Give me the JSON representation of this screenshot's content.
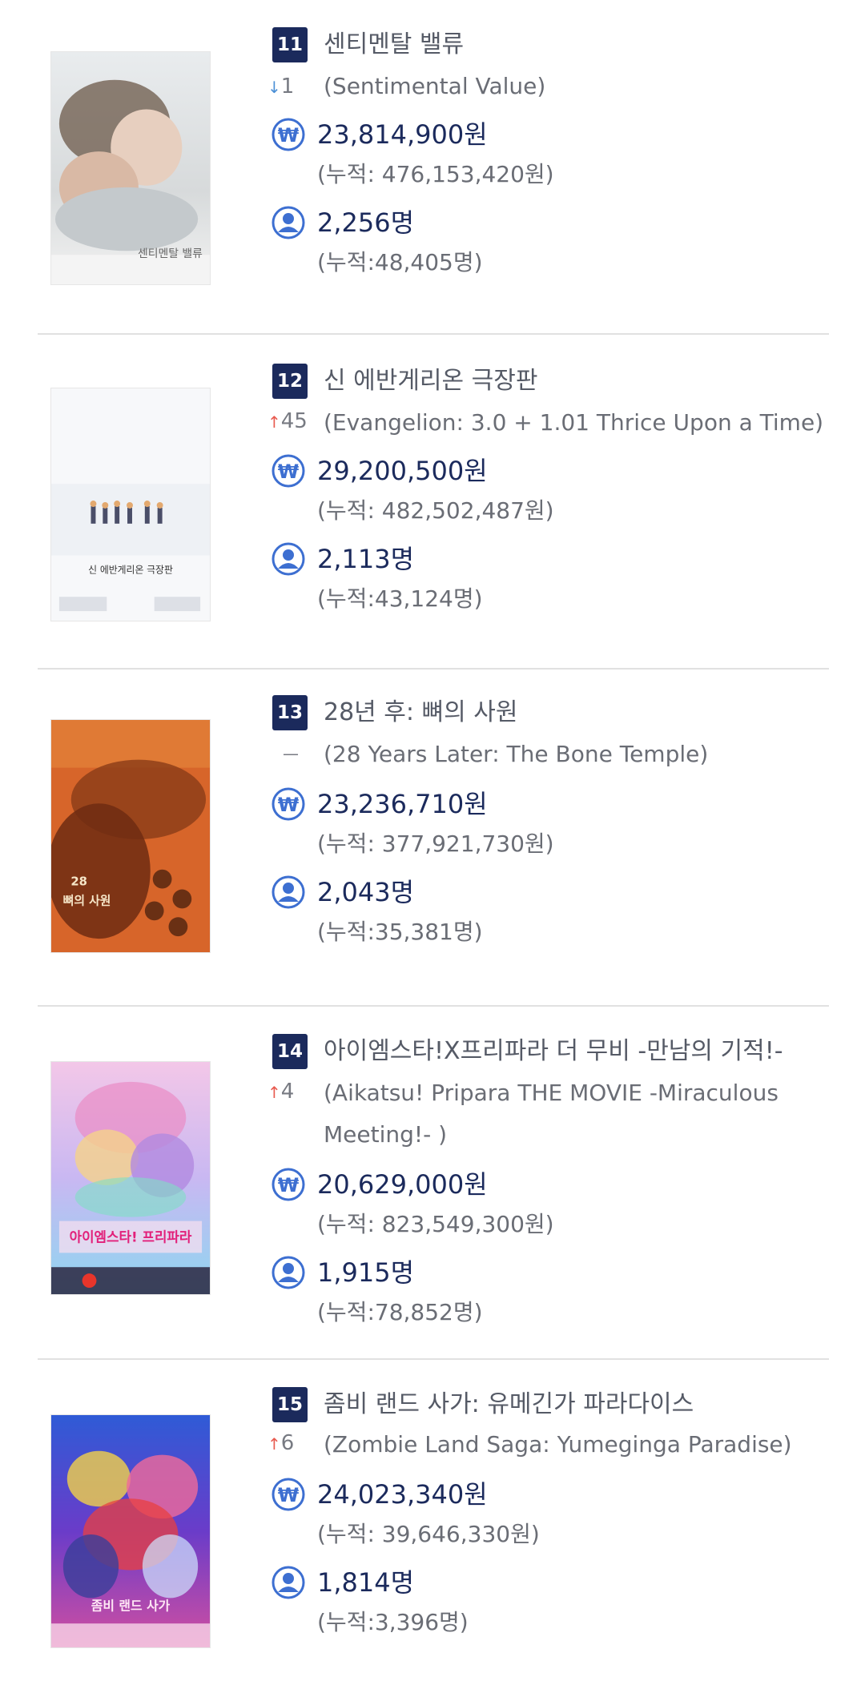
{
  "colors": {
    "badge": "#1b2a5c",
    "up_arrow": "#e85a4f",
    "down_arrow": "#4a8fd6",
    "icon": "#3d6fd1",
    "value_text": "#1b2a5c",
    "divider": "#e1e1e1"
  },
  "icons": {
    "revenue": "won-currency-icon",
    "audience": "person-icon",
    "up": "arrow-up-icon",
    "down": "arrow-down-icon",
    "same": "dash-icon"
  },
  "movies": [
    {
      "rank": "11",
      "title_ko": "센티멘탈 밸류",
      "title_en": "(Sentimental Value)",
      "change_dir": "down",
      "change_arrow": "↓",
      "change_value": "1",
      "revenue": "23,814,900원",
      "revenue_total": "(누적: 476,153,420원)",
      "audience": "2,256명",
      "audience_total": "(누적:48,405명)",
      "poster_text": "센티멘탈 밸류"
    },
    {
      "rank": "12",
      "title_ko": "신 에반게리온 극장판",
      "title_en": "(Evangelion: 3.0 + 1.01 Thrice Upon a Time)",
      "change_dir": "up",
      "change_arrow": "↑",
      "change_value": "45",
      "revenue": "29,200,500원",
      "revenue_total": "(누적: 482,502,487원)",
      "audience": "2,113명",
      "audience_total": "(누적:43,124명)",
      "poster_text": "신 에반게리온 극장판"
    },
    {
      "rank": "13",
      "title_ko": "28년 후: 뼈의 사원",
      "title_en": "(28 Years Later: The Bone Temple)",
      "change_dir": "same",
      "change_arrow": "—",
      "change_value": "",
      "revenue": "23,236,710원",
      "revenue_total": "(누적: 377,921,730원)",
      "audience": "2,043명",
      "audience_total": "(누적:35,381명)",
      "poster_text": "뼈의 사원"
    },
    {
      "rank": "14",
      "title_ko": "아이엠스타!X프리파라 더 무비 -만남의 기적!-",
      "title_en": "(Aikatsu! Pripara THE MOVIE -Miraculous Meeting!- )",
      "change_dir": "up",
      "change_arrow": "↑",
      "change_value": "4",
      "revenue": "20,629,000원",
      "revenue_total": "(누적: 823,549,300원)",
      "audience": "1,915명",
      "audience_total": "(누적:78,852명)",
      "poster_text": "아이엠스타! 프리파라"
    },
    {
      "rank": "15",
      "title_ko": "좀비 랜드 사가: 유메긴가 파라다이스",
      "title_en": "(Zombie Land Saga: Yumeginga Paradise)",
      "change_dir": "up",
      "change_arrow": "↑",
      "change_value": "6",
      "revenue": "24,023,340원",
      "revenue_total": "(누적: 39,646,330원)",
      "audience": "1,814명",
      "audience_total": "(누적:3,396명)",
      "poster_text": "좀비 랜드 사가"
    }
  ]
}
